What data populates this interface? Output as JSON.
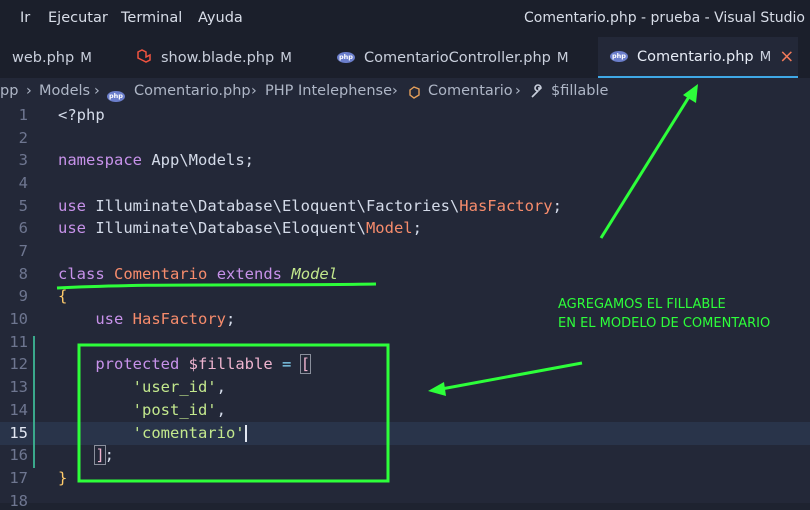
{
  "menubar": {
    "items": [
      "Ir",
      "Ejecutar",
      "Terminal",
      "Ayuda"
    ],
    "window_title": "Comentario.php - prueba - Visual Studio Code"
  },
  "tabs": [
    {
      "label": "web.php",
      "modified": "M"
    },
    {
      "label": "show.blade.php",
      "modified": "M"
    },
    {
      "label": "ComentarioController.php",
      "modified": "M"
    },
    {
      "label": "Comentario.php",
      "modified": "M",
      "close": "×"
    }
  ],
  "breadcrumb": [
    "pp",
    "Models",
    "Comentario.php",
    "PHP Intelephense",
    "Comentario",
    "$fillable"
  ],
  "breadcrumb_sep": "›",
  "line_numbers": [
    "1",
    "2",
    "3",
    "4",
    "5",
    "6",
    "7",
    "8",
    "9",
    "10",
    "11",
    "12",
    "13",
    "14",
    "15",
    "16",
    "17",
    "18"
  ],
  "code": {
    "l1": "<?php",
    "l3_kw": "namespace",
    "l3_rest": " App\\Models;",
    "l5_kw": "use",
    "l5_rest": " Illuminate\\Database\\Eloquent\\Factories\\",
    "l5_cls": "HasFactory",
    "l5_end": ";",
    "l6_kw": "use",
    "l6_rest": " Illuminate\\Database\\Eloquent\\",
    "l6_cls": "Model",
    "l6_end": ";",
    "l8_kw1": "class",
    "l8_cls": "Comentario",
    "l8_kw2": "extends",
    "l8_model": "Model",
    "l9": "{",
    "l10_kw": "use",
    "l10_cls": "HasFactory",
    "l10_end": ";",
    "l12_kw": "protected",
    "l12_var": "$fillable",
    "l12_op": "=",
    "l12_brk": "[",
    "l13_str": "'user_id'",
    "l13_end": ",",
    "l14_str": "'post_id'",
    "l14_end": ",",
    "l15_str": "'comentario'",
    "l16_brk": "]",
    "l16_end": ";",
    "l17": "}"
  },
  "annotation": {
    "line1": "AGREGAMOS EL FILLABLE",
    "line2": "EN EL MODELO DE COMENTARIO"
  },
  "colors": {
    "annotation_green": "#2dff3a",
    "accent": "#3fa8e6"
  }
}
